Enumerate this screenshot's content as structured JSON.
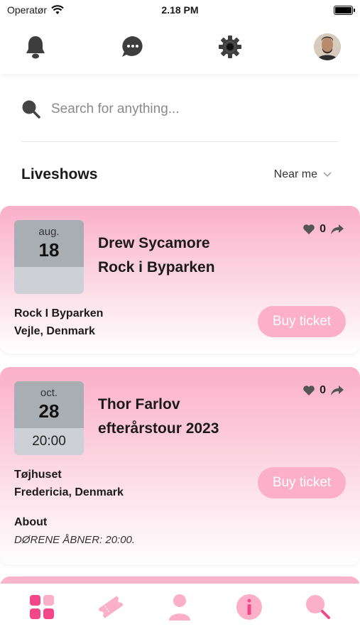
{
  "status_bar": {
    "carrier": "Operatør",
    "time": "2.18 PM"
  },
  "search": {
    "placeholder": "Search for anything..."
  },
  "section": {
    "title": "Liveshows",
    "filter_label": "Near me"
  },
  "events": [
    {
      "month": "aug.",
      "day": "18",
      "time": "",
      "title_line1": "Drew Sycamore",
      "title_line2": "Rock i Byparken",
      "likes": "0",
      "venue": "Rock I Byparken",
      "location": "Vejle, Denmark",
      "button_label": "Buy ticket"
    },
    {
      "month": "oct.",
      "day": "28",
      "time": "20:00",
      "title_line1": "Thor Farlov",
      "title_line2": "efterårstour 2023",
      "likes": "0",
      "venue": "Tøjhuset",
      "location": "Fredericia, Denmark",
      "button_label": "Buy ticket",
      "about_label": "About",
      "about_text": "DØRENE ÅBNER: 20:00."
    }
  ],
  "colors": {
    "accent": "#f4478a",
    "accent_light": "#fbafc9",
    "icon_gray": "#3e3e3e"
  },
  "icons": {
    "top_bar": [
      "bell-icon",
      "chat-icon",
      "gear-icon",
      "avatar"
    ],
    "bottom_nav": [
      "grid-icon",
      "ticket-icon",
      "user-icon",
      "info-icon",
      "search-icon"
    ]
  }
}
